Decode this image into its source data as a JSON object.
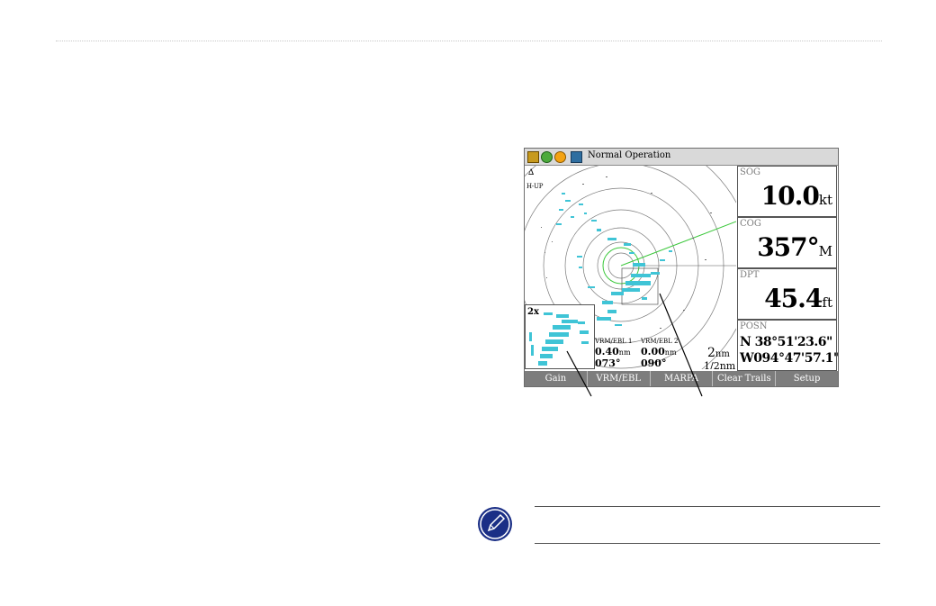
{
  "device": {
    "status_text": "Normal Operation",
    "status_icons": [
      "chart-icon",
      "gps-icon",
      "satellite-icon",
      "radar-icon"
    ]
  },
  "radar": {
    "north_arrow": "∆",
    "orientation": "H-UP",
    "zoom_label": "2x",
    "vrm1": {
      "label": "VRM/EBL 1",
      "distance": "0.40",
      "unit": "nm",
      "bearing": "073°"
    },
    "vrm2": {
      "label": "VRM/EBL 2",
      "distance": "0.00",
      "unit": "nm",
      "bearing": "090°"
    },
    "range": "2",
    "range_unit": "nm",
    "ring_spacing": "1/2nm"
  },
  "panels": {
    "sog": {
      "label": "SOG",
      "value": "10.0",
      "unit": "kt"
    },
    "cog": {
      "label": "COG",
      "value": "357°",
      "unit": "M"
    },
    "dpt": {
      "label": "DPT",
      "value": "45.4",
      "unit": "ft"
    },
    "posn": {
      "label": "POSN",
      "lat": "N  38°51'23.6\"",
      "lon": "W094°47'57.1\""
    }
  },
  "softkeys": [
    "Gain",
    "VRM/EBL",
    "MARPA",
    "Clear Trails",
    "Setup"
  ],
  "colors": {
    "echo": "#3fc4d6",
    "heading_line": "#3cc83c",
    "softkey_bg": "#7d7d7d",
    "status_bg": "#d9d9d9",
    "note_icon": "#1b2f86"
  }
}
